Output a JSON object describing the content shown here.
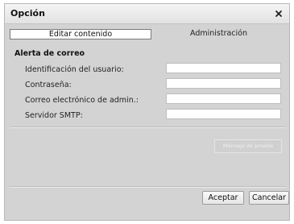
{
  "window": {
    "title": "Opción"
  },
  "tabs": [
    {
      "label": "Editar contenido",
      "active": true
    },
    {
      "label": "Administración",
      "active": false
    }
  ],
  "mail_alert": {
    "section_title": "Alerta de correo",
    "fields": [
      {
        "label": "Identificación del usuario:",
        "value": ""
      },
      {
        "label": "Contraseña:",
        "value": ""
      },
      {
        "label": "Correo electrónico de admin.:",
        "value": ""
      },
      {
        "label": "Servidor SMTP:",
        "value": ""
      }
    ],
    "test_button": "Mensaje de prueba"
  },
  "footer": {
    "ok": "Aceptar",
    "cancel": "Cancelar"
  },
  "icons": {
    "close": "close-icon"
  },
  "colors": {
    "dialog_bg": "#d3d3d3",
    "field_bg": "#ffffff"
  }
}
